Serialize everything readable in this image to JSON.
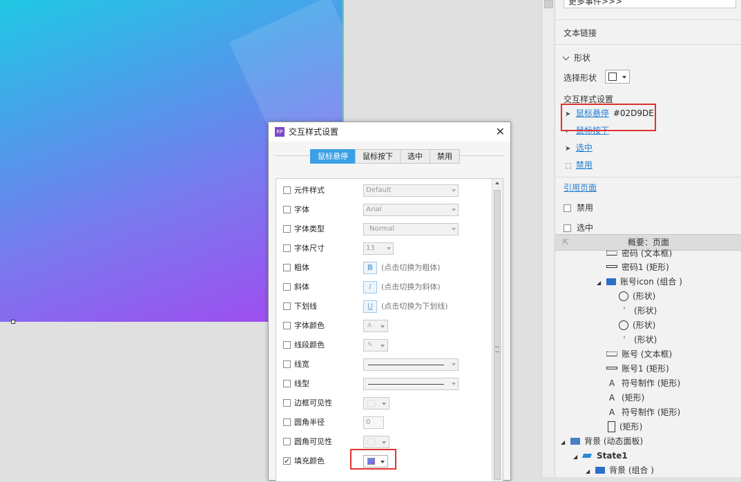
{
  "right_panel": {
    "more_events": "更多事件>>>",
    "text_link": "文本链接",
    "shape_section": "形状",
    "select_shape_label": "选择形状",
    "interaction_style_settings": "交互样式设置",
    "interactions": [
      {
        "label": "鼠标悬停",
        "value": "#02D9DE;"
      },
      {
        "label": "鼠标按下",
        "value": ""
      },
      {
        "label": "选中",
        "value": ""
      },
      {
        "label": "禁用",
        "value": ""
      }
    ],
    "reference_page": "引用页面",
    "disabled_checkbox": "禁用",
    "selected_checkbox": "选中"
  },
  "outline": {
    "header": "概要：页面",
    "items": [
      {
        "label": "密码 (文本框)",
        "icon": "text-field-icon"
      },
      {
        "label": "密码1 (矩形)",
        "icon": "rectangle-icon"
      },
      {
        "label": "账号icon (组合 )",
        "icon": "folder-icon"
      },
      {
        "label": "(形状)",
        "icon": "user-circle-icon"
      },
      {
        "label": "(形状)",
        "icon": "shape-icon"
      },
      {
        "label": "(形状)",
        "icon": "circle-icon"
      },
      {
        "label": "(形状)",
        "icon": "shape-icon"
      },
      {
        "label": "账号 (文本框)",
        "icon": "text-field-icon"
      },
      {
        "label": "账号1 (矩形)",
        "icon": "rectangle-icon"
      },
      {
        "label": "符号制作 (矩形)",
        "icon": "text-a-icon"
      },
      {
        "label": "(矩形)",
        "icon": "text-a-icon"
      },
      {
        "label": "符号制作 (矩形)",
        "icon": "text-a-icon"
      },
      {
        "label": "(矩形)",
        "icon": "portrait-rect-icon"
      },
      {
        "label": "背景 (动态面板)",
        "icon": "dynamic-panel-icon"
      },
      {
        "label": "State1",
        "icon": "state-icon"
      },
      {
        "label": "背景 (组合 )",
        "icon": "folder-icon"
      }
    ]
  },
  "dialog": {
    "title": "交互样式设置",
    "tabs": [
      "鼠标悬停",
      "鼠标按下",
      "选中",
      "禁用"
    ],
    "active_tab": "鼠标悬停",
    "properties": [
      {
        "label": "元件样式",
        "checked": false,
        "value": "Default"
      },
      {
        "label": "字体",
        "checked": false,
        "value": "Arial"
      },
      {
        "label": "字体类型",
        "checked": false,
        "value": "Normal"
      },
      {
        "label": "字体尺寸",
        "checked": false,
        "value": "13"
      },
      {
        "label": "粗体",
        "checked": false,
        "button": "B",
        "hint": "(点击切换为粗体)"
      },
      {
        "label": "斜体",
        "checked": false,
        "button": "I",
        "hint": "(点击切换为斜体)"
      },
      {
        "label": "下划线",
        "checked": false,
        "button": "U",
        "hint": "(点击切换为下划线)"
      },
      {
        "label": "字体颜色",
        "checked": false
      },
      {
        "label": "线段颜色",
        "checked": false
      },
      {
        "label": "线宽",
        "checked": false
      },
      {
        "label": "线型",
        "checked": false
      },
      {
        "label": "边框可见性",
        "checked": false
      },
      {
        "label": "圆角半径",
        "checked": false,
        "value": "0"
      },
      {
        "label": "圆角可见性",
        "checked": false
      },
      {
        "label": "填充颜色",
        "checked": true
      }
    ]
  },
  "colors": {
    "accent": "#3ba0e5",
    "link": "#1e7fd6",
    "highlight_box": "#e03131",
    "gradient_top": "#1fc8e4",
    "gradient_bottom": "#a448f0"
  }
}
